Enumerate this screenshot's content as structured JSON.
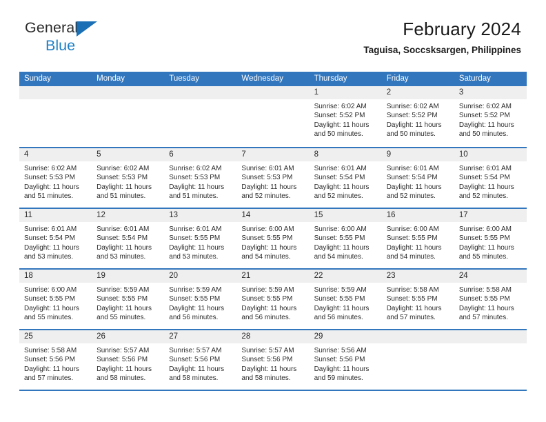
{
  "brand": {
    "line1": "General",
    "line2": "Blue",
    "triangle_color": "#1a6fb5",
    "blue_color": "#1e80c7"
  },
  "header": {
    "title": "February 2024",
    "subtitle": "Taguisa, Soccsksargen, Philippines"
  },
  "theme": {
    "header_blue": "#3276bd",
    "day_band_gray": "#efefef"
  },
  "weekdays": [
    "Sunday",
    "Monday",
    "Tuesday",
    "Wednesday",
    "Thursday",
    "Friday",
    "Saturday"
  ],
  "weeks": [
    [
      {
        "day": "",
        "lines": []
      },
      {
        "day": "",
        "lines": []
      },
      {
        "day": "",
        "lines": []
      },
      {
        "day": "",
        "lines": []
      },
      {
        "day": "1",
        "lines": [
          "Sunrise: 6:02 AM",
          "Sunset: 5:52 PM",
          "Daylight: 11 hours",
          "and 50 minutes."
        ]
      },
      {
        "day": "2",
        "lines": [
          "Sunrise: 6:02 AM",
          "Sunset: 5:52 PM",
          "Daylight: 11 hours",
          "and 50 minutes."
        ]
      },
      {
        "day": "3",
        "lines": [
          "Sunrise: 6:02 AM",
          "Sunset: 5:52 PM",
          "Daylight: 11 hours",
          "and 50 minutes."
        ]
      }
    ],
    [
      {
        "day": "4",
        "lines": [
          "Sunrise: 6:02 AM",
          "Sunset: 5:53 PM",
          "Daylight: 11 hours",
          "and 51 minutes."
        ]
      },
      {
        "day": "5",
        "lines": [
          "Sunrise: 6:02 AM",
          "Sunset: 5:53 PM",
          "Daylight: 11 hours",
          "and 51 minutes."
        ]
      },
      {
        "day": "6",
        "lines": [
          "Sunrise: 6:02 AM",
          "Sunset: 5:53 PM",
          "Daylight: 11 hours",
          "and 51 minutes."
        ]
      },
      {
        "day": "7",
        "lines": [
          "Sunrise: 6:01 AM",
          "Sunset: 5:53 PM",
          "Daylight: 11 hours",
          "and 52 minutes."
        ]
      },
      {
        "day": "8",
        "lines": [
          "Sunrise: 6:01 AM",
          "Sunset: 5:54 PM",
          "Daylight: 11 hours",
          "and 52 minutes."
        ]
      },
      {
        "day": "9",
        "lines": [
          "Sunrise: 6:01 AM",
          "Sunset: 5:54 PM",
          "Daylight: 11 hours",
          "and 52 minutes."
        ]
      },
      {
        "day": "10",
        "lines": [
          "Sunrise: 6:01 AM",
          "Sunset: 5:54 PM",
          "Daylight: 11 hours",
          "and 52 minutes."
        ]
      }
    ],
    [
      {
        "day": "11",
        "lines": [
          "Sunrise: 6:01 AM",
          "Sunset: 5:54 PM",
          "Daylight: 11 hours",
          "and 53 minutes."
        ]
      },
      {
        "day": "12",
        "lines": [
          "Sunrise: 6:01 AM",
          "Sunset: 5:54 PM",
          "Daylight: 11 hours",
          "and 53 minutes."
        ]
      },
      {
        "day": "13",
        "lines": [
          "Sunrise: 6:01 AM",
          "Sunset: 5:55 PM",
          "Daylight: 11 hours",
          "and 53 minutes."
        ]
      },
      {
        "day": "14",
        "lines": [
          "Sunrise: 6:00 AM",
          "Sunset: 5:55 PM",
          "Daylight: 11 hours",
          "and 54 minutes."
        ]
      },
      {
        "day": "15",
        "lines": [
          "Sunrise: 6:00 AM",
          "Sunset: 5:55 PM",
          "Daylight: 11 hours",
          "and 54 minutes."
        ]
      },
      {
        "day": "16",
        "lines": [
          "Sunrise: 6:00 AM",
          "Sunset: 5:55 PM",
          "Daylight: 11 hours",
          "and 54 minutes."
        ]
      },
      {
        "day": "17",
        "lines": [
          "Sunrise: 6:00 AM",
          "Sunset: 5:55 PM",
          "Daylight: 11 hours",
          "and 55 minutes."
        ]
      }
    ],
    [
      {
        "day": "18",
        "lines": [
          "Sunrise: 6:00 AM",
          "Sunset: 5:55 PM",
          "Daylight: 11 hours",
          "and 55 minutes."
        ]
      },
      {
        "day": "19",
        "lines": [
          "Sunrise: 5:59 AM",
          "Sunset: 5:55 PM",
          "Daylight: 11 hours",
          "and 55 minutes."
        ]
      },
      {
        "day": "20",
        "lines": [
          "Sunrise: 5:59 AM",
          "Sunset: 5:55 PM",
          "Daylight: 11 hours",
          "and 56 minutes."
        ]
      },
      {
        "day": "21",
        "lines": [
          "Sunrise: 5:59 AM",
          "Sunset: 5:55 PM",
          "Daylight: 11 hours",
          "and 56 minutes."
        ]
      },
      {
        "day": "22",
        "lines": [
          "Sunrise: 5:59 AM",
          "Sunset: 5:55 PM",
          "Daylight: 11 hours",
          "and 56 minutes."
        ]
      },
      {
        "day": "23",
        "lines": [
          "Sunrise: 5:58 AM",
          "Sunset: 5:55 PM",
          "Daylight: 11 hours",
          "and 57 minutes."
        ]
      },
      {
        "day": "24",
        "lines": [
          "Sunrise: 5:58 AM",
          "Sunset: 5:55 PM",
          "Daylight: 11 hours",
          "and 57 minutes."
        ]
      }
    ],
    [
      {
        "day": "25",
        "lines": [
          "Sunrise: 5:58 AM",
          "Sunset: 5:56 PM",
          "Daylight: 11 hours",
          "and 57 minutes."
        ]
      },
      {
        "day": "26",
        "lines": [
          "Sunrise: 5:57 AM",
          "Sunset: 5:56 PM",
          "Daylight: 11 hours",
          "and 58 minutes."
        ]
      },
      {
        "day": "27",
        "lines": [
          "Sunrise: 5:57 AM",
          "Sunset: 5:56 PM",
          "Daylight: 11 hours",
          "and 58 minutes."
        ]
      },
      {
        "day": "28",
        "lines": [
          "Sunrise: 5:57 AM",
          "Sunset: 5:56 PM",
          "Daylight: 11 hours",
          "and 58 minutes."
        ]
      },
      {
        "day": "29",
        "lines": [
          "Sunrise: 5:56 AM",
          "Sunset: 5:56 PM",
          "Daylight: 11 hours",
          "and 59 minutes."
        ]
      },
      {
        "day": "",
        "lines": []
      },
      {
        "day": "",
        "lines": []
      }
    ]
  ]
}
